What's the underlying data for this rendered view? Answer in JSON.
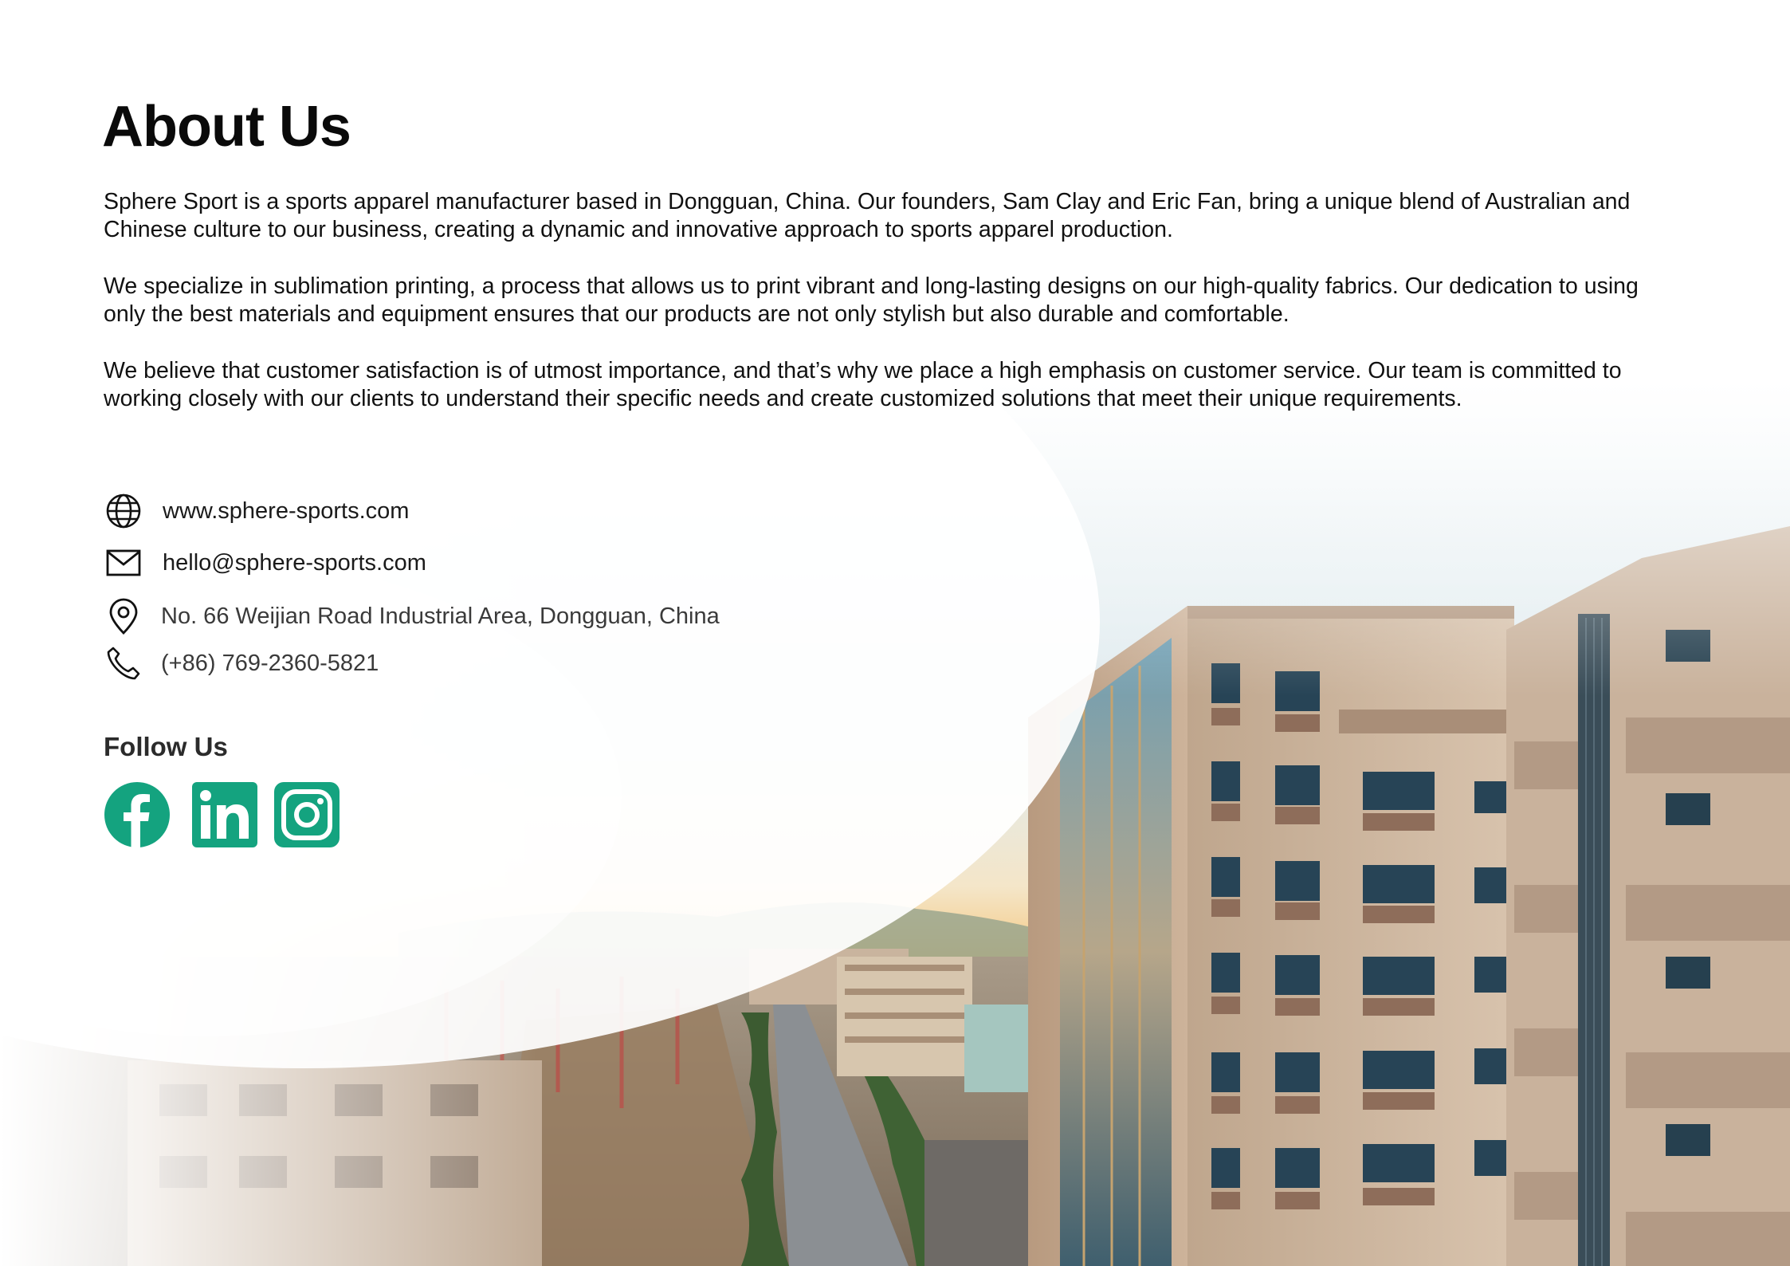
{
  "about": {
    "title": "About Us",
    "paragraphs": [
      "Sphere Sport is a sports apparel manufacturer based in Dongguan, China. Our founders, Sam Clay and Eric Fan, bring a unique blend of Australian and Chinese culture to our business, creating a dynamic and innovative approach to sports apparel production.",
      "We specialize in sublimation printing, a process that allows us to print vibrant and long-lasting designs on our high-quality fabrics. Our dedication to using only the best materials and equipment ensures that our products are not only stylish but also durable and comfortable.",
      "We believe that customer satisfaction is of utmost importance, and that’s why we place a high emphasis on customer service. Our team is committed to working closely with our clients to understand their specific needs and create customized solutions that meet their unique requirements."
    ]
  },
  "contact": {
    "website": {
      "icon": "globe-icon",
      "text": "www.sphere-sports.com"
    },
    "email": {
      "icon": "mail-icon",
      "text": "hello@sphere-sports.com"
    },
    "address": {
      "icon": "location-pin-icon",
      "text": "No. 66 Weijian Road Industrial Area, Dongguan, China"
    },
    "phone": {
      "icon": "phone-icon",
      "text": "(+86) 769-2360-5821"
    }
  },
  "follow": {
    "heading": "Follow Us",
    "icons": [
      "facebook-icon",
      "linkedin-icon",
      "instagram-icon"
    ]
  },
  "colors": {
    "social_green": "#14a37f",
    "text": "#111111",
    "background": "#ffffff"
  }
}
